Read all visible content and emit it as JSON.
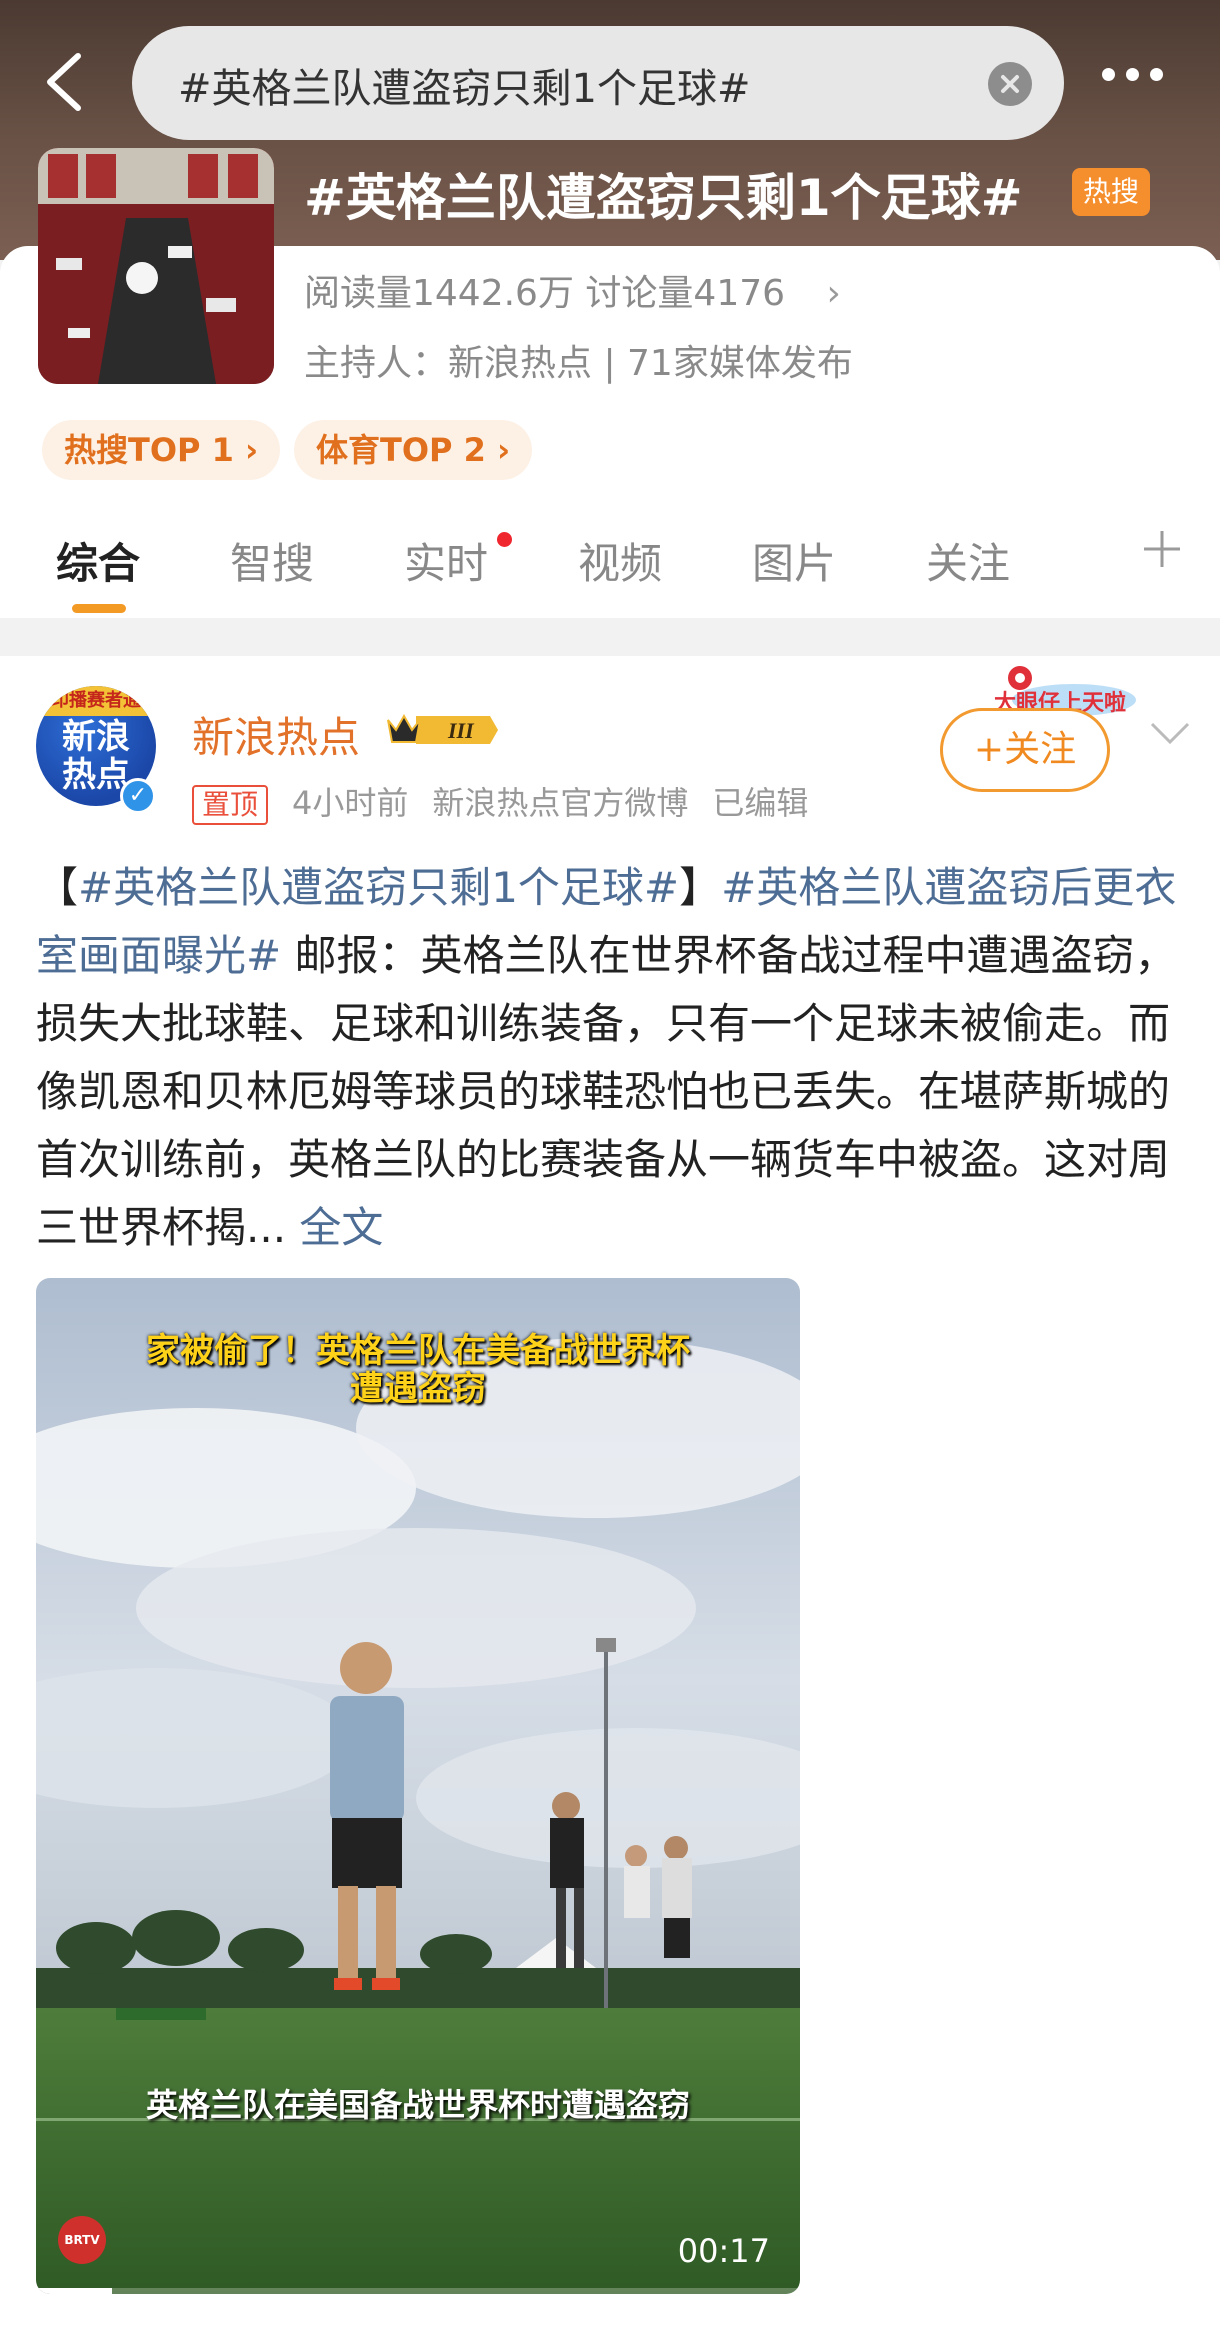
{
  "search": {
    "query": "#英格兰队遭盗窃只剩1个足球#"
  },
  "topic": {
    "title": "#英格兰队遭盗窃只剩1个足球#",
    "hot_label": "热搜",
    "stats": "阅读量1442.6万  讨论量4176",
    "host": "主持人：新浪热点 | 71家媒体发布",
    "ranks": [
      "热搜TOP 1 ›",
      "体育TOP 2 ›"
    ]
  },
  "tabs": [
    "综合",
    "智搜",
    "实时",
    "视频",
    "图片",
    "关注"
  ],
  "post": {
    "author": "新浪热点",
    "avatar_banner": "印播赛者通",
    "avatar_text": "新浪热点",
    "pin_label": "置顶",
    "time": "4小时前",
    "source": "新浪热点官方微博",
    "edited": "已编辑",
    "follow_label": "+关注",
    "deco_label": "大眼仔上天啦",
    "body_prefix": "【",
    "body_tag1": "#英格兰队遭盗窃只剩1个足球#",
    "body_bracket_close": "】",
    "body_tag2": "#英格兰队遭盗窃后更衣室画面曝光#",
    "body_text": " 邮报：英格兰队在世界杯备战过程中遭遇盗窃，损失大批球鞋、足球和训练装备，只有一个足球未被偷走。而像凯恩和贝林厄姆等球员的球鞋恐怕也已丢失。在堪萨斯城的首次训练前，英格兰队的比赛装备从一辆货车中被盗。这对周三世界杯揭... ",
    "read_more": "全文"
  },
  "video": {
    "caption_top_line1": "家被偷了！英格兰队在美备战世界杯",
    "caption_top_line2": "遭遇盗窃",
    "caption_bottom": "英格兰队在美国备战世界杯时遭遇盗窃",
    "duration": "00:17",
    "station": "BRTV",
    "progress": 0.1
  },
  "colors": {
    "accent": "#f39a25",
    "link": "#4e6d95",
    "hot": "#f58f2d",
    "author": "#e2722a"
  }
}
